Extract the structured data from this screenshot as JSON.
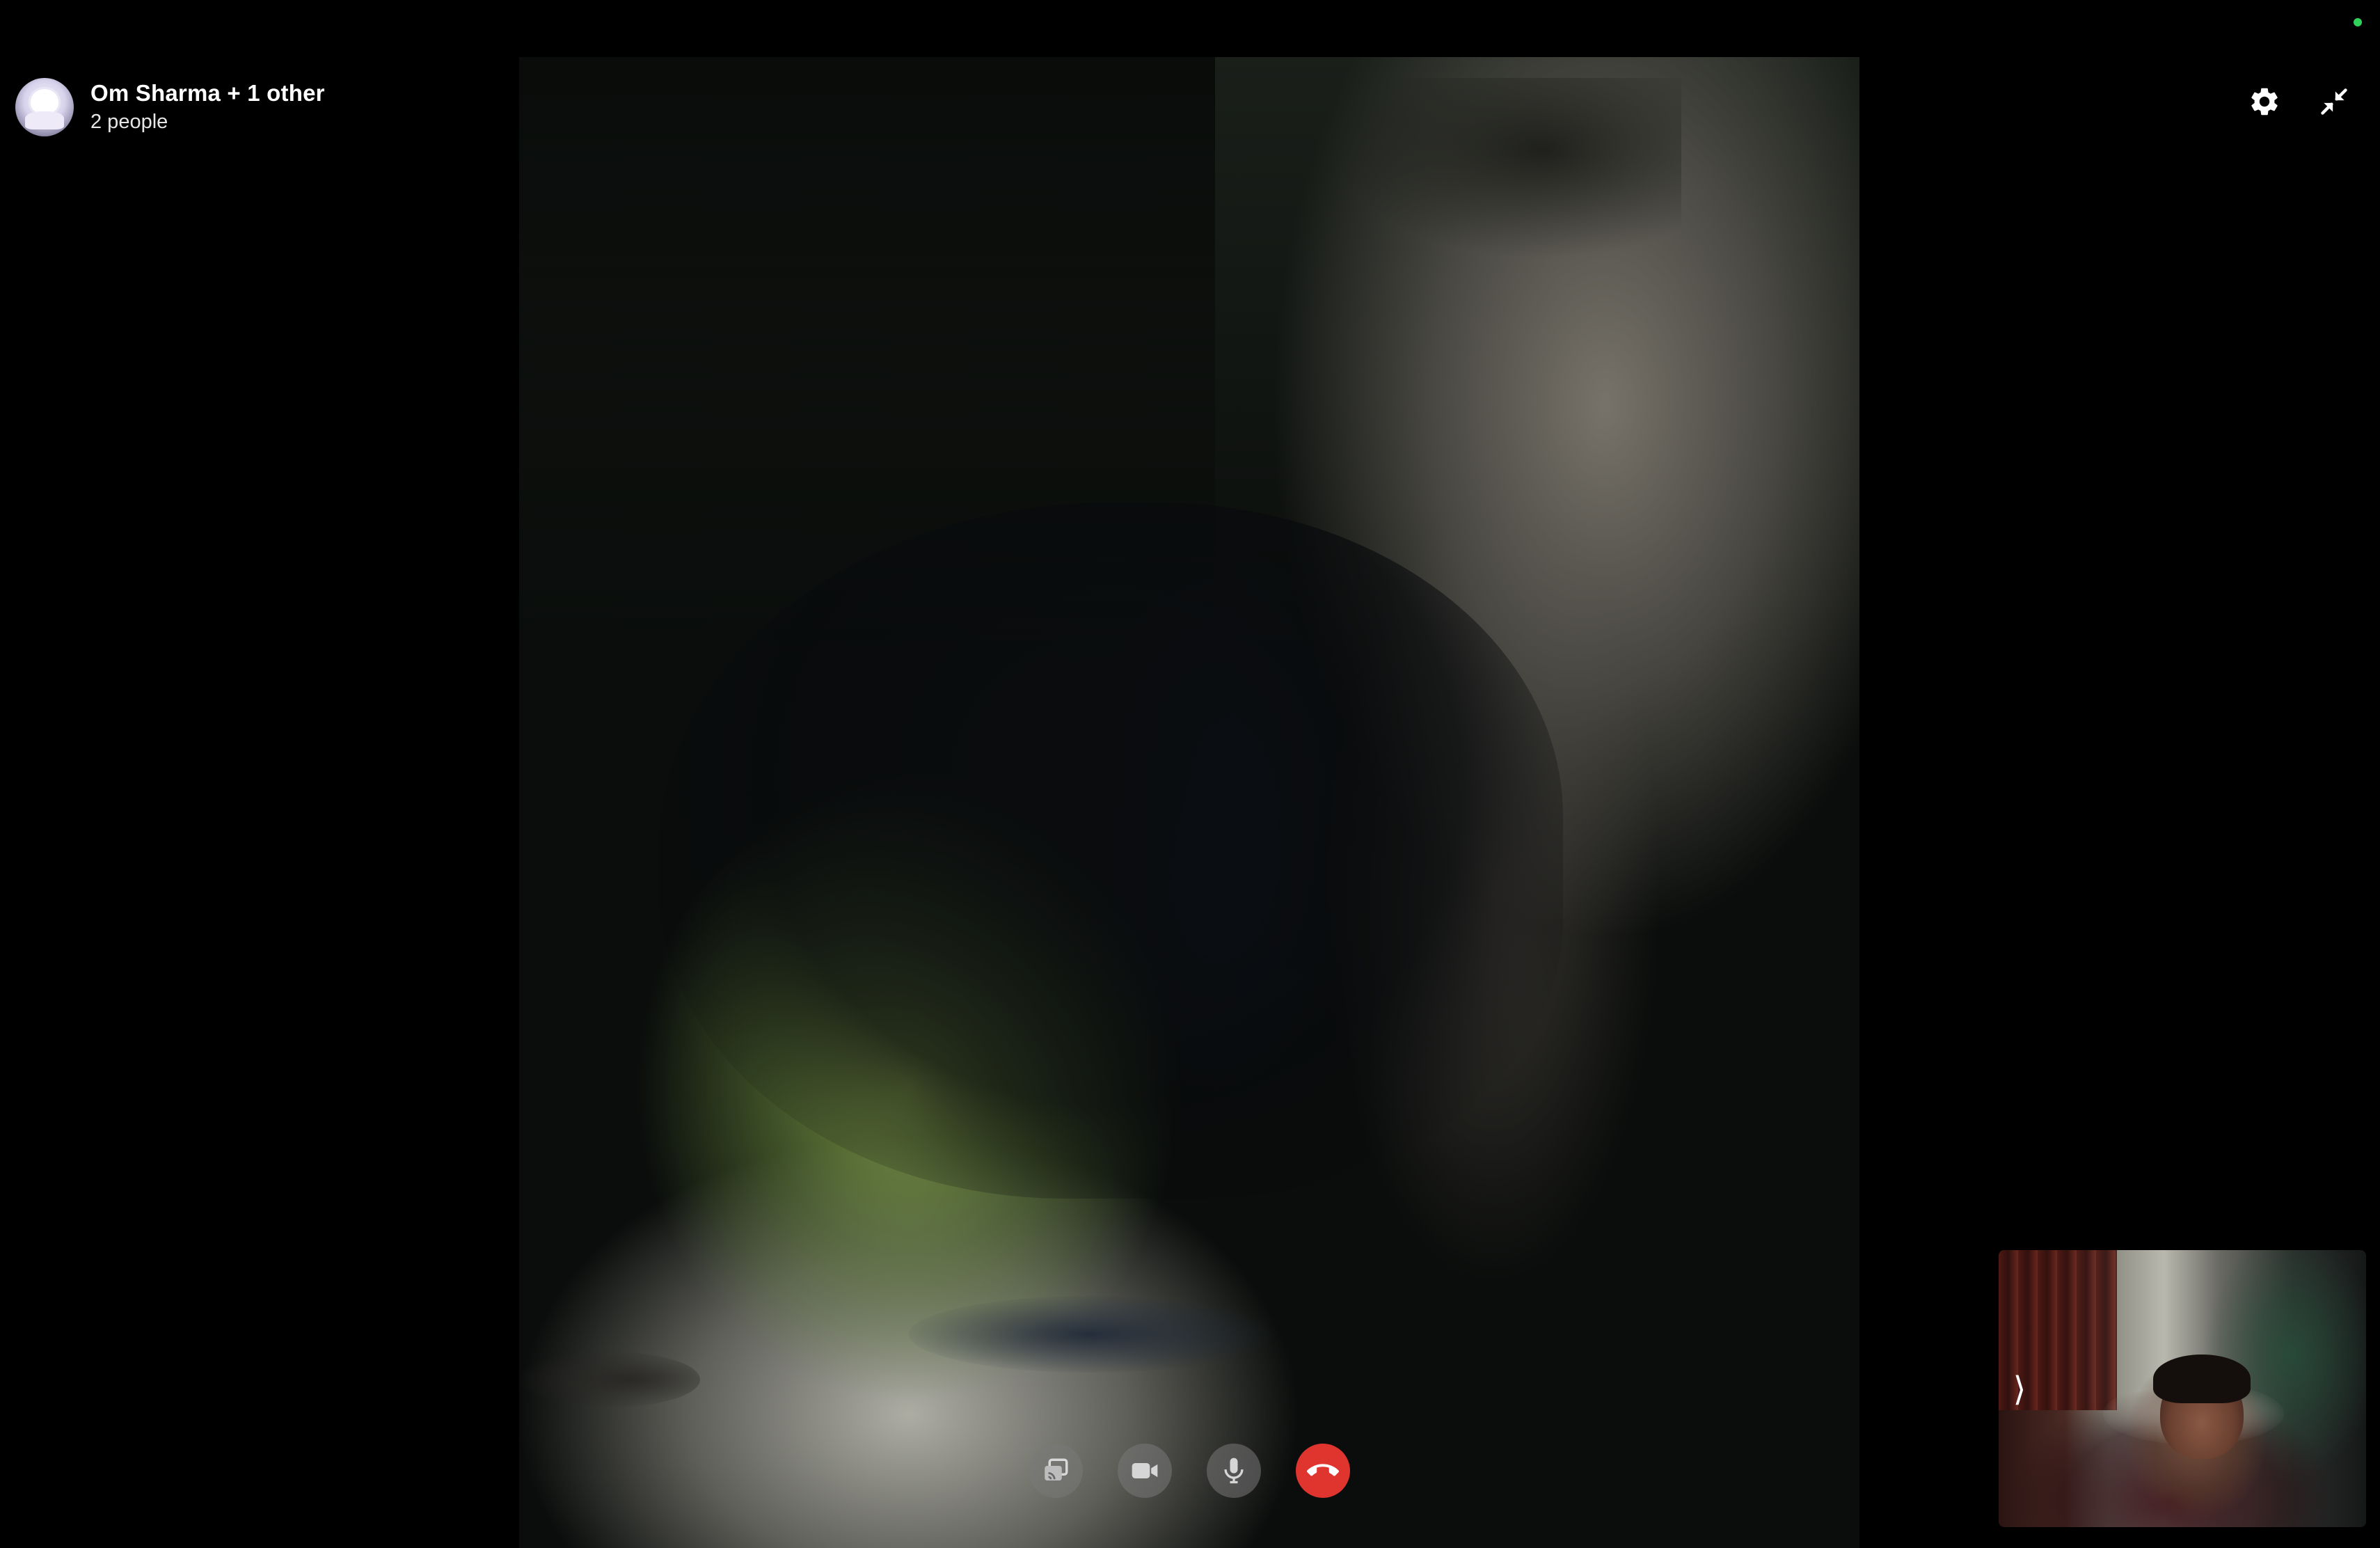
{
  "call": {
    "title": "Om Sharma + 1 other",
    "subtitle": "2 people"
  },
  "icons": {
    "avatar": "group-avatar",
    "settings": "gear-icon",
    "minimize": "collapse-arrows-icon",
    "share": "screen-share-icon",
    "camera": "video-camera-icon",
    "microphone": "microphone-icon",
    "end_call": "phone-hangup-icon",
    "self_expand": "chevron-right-icon"
  },
  "self_preview": {
    "expand_glyph": "⟩"
  },
  "colors": {
    "background": "#000000",
    "status_dot": "#30d158",
    "end_call": "#e0342e",
    "control_grey": "#787878"
  }
}
